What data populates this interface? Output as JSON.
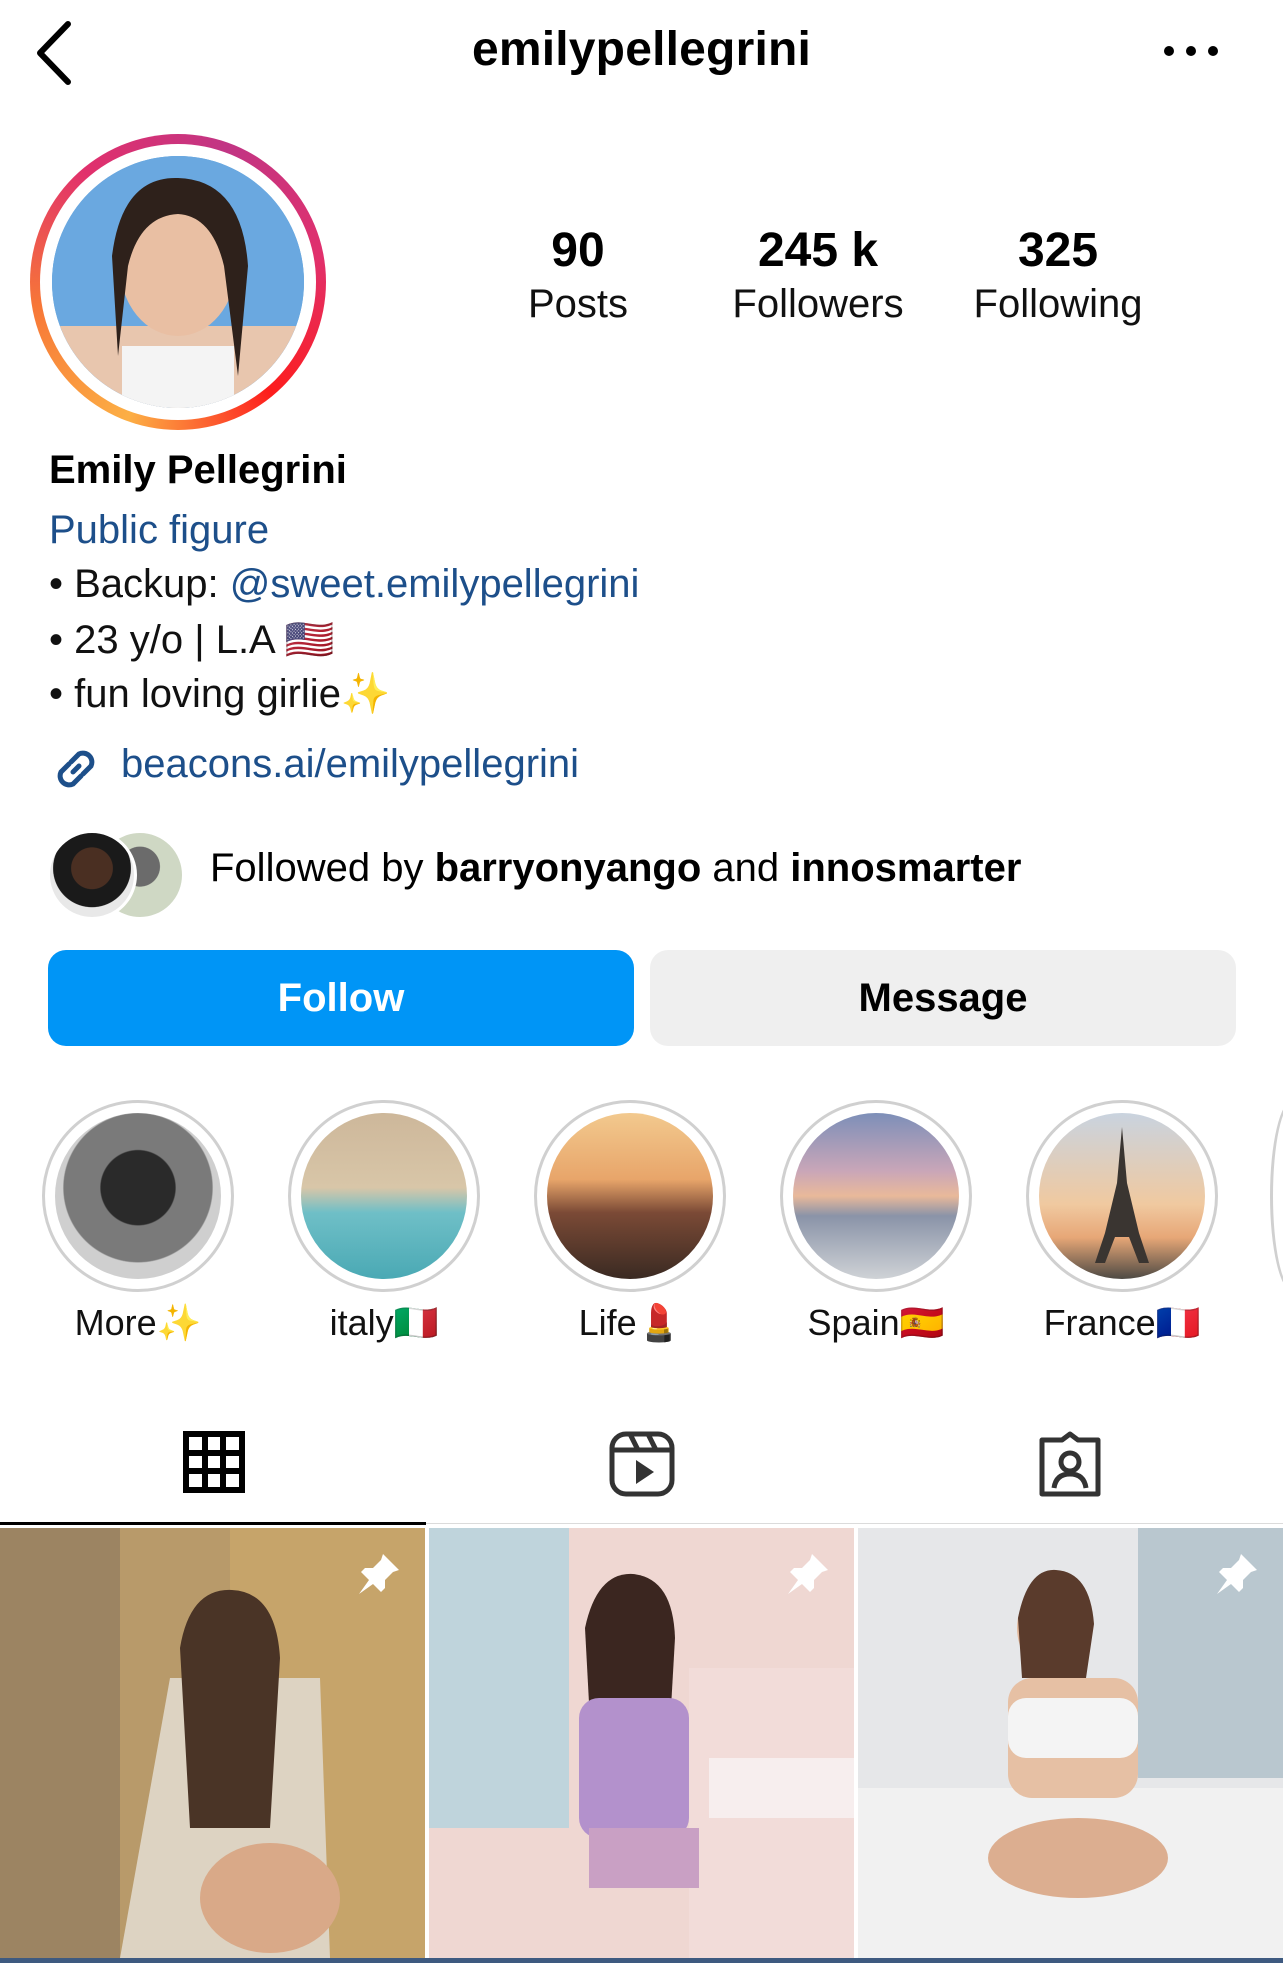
{
  "header": {
    "username": "emilypellegrini",
    "back_icon": "chevron-left-icon",
    "more_icon": "more-horizontal-icon"
  },
  "stats": [
    {
      "value": "90",
      "label": "Posts"
    },
    {
      "value": "245 k",
      "label": "Followers"
    },
    {
      "value": "325",
      "label": "Following"
    }
  ],
  "bio": {
    "name": "Emily Pellegrini",
    "category": "Public figure",
    "line1_prefix": "• Backup: ",
    "line1_mention": "@sweet.emilypellegrini",
    "line2": "• 23 y/o | L.A 🇺🇸",
    "line3": "• fun loving girlie✨",
    "link": "beacons.ai/emilypellegrini"
  },
  "followed_by": {
    "prefix": "Followed by ",
    "user1": "barryonyango",
    "joiner": " and ",
    "user2": "innosmarter"
  },
  "buttons": {
    "follow": "Follow",
    "message": "Message"
  },
  "highlights": [
    {
      "label": "More✨"
    },
    {
      "label": "italy🇮🇹"
    },
    {
      "label": "Life💄"
    },
    {
      "label": "Spain🇪🇸"
    },
    {
      "label": "France🇫🇷"
    }
  ],
  "tabs": [
    {
      "name": "grid-icon",
      "active": true
    },
    {
      "name": "reels-icon",
      "active": false
    },
    {
      "name": "tagged-icon",
      "active": false
    }
  ],
  "posts": [
    {
      "pinned": true
    },
    {
      "pinned": true
    },
    {
      "pinned": true
    }
  ],
  "colors": {
    "accent_blue": "#0095f6",
    "link_blue": "#1d4f8a",
    "message_bg": "#efefef"
  }
}
